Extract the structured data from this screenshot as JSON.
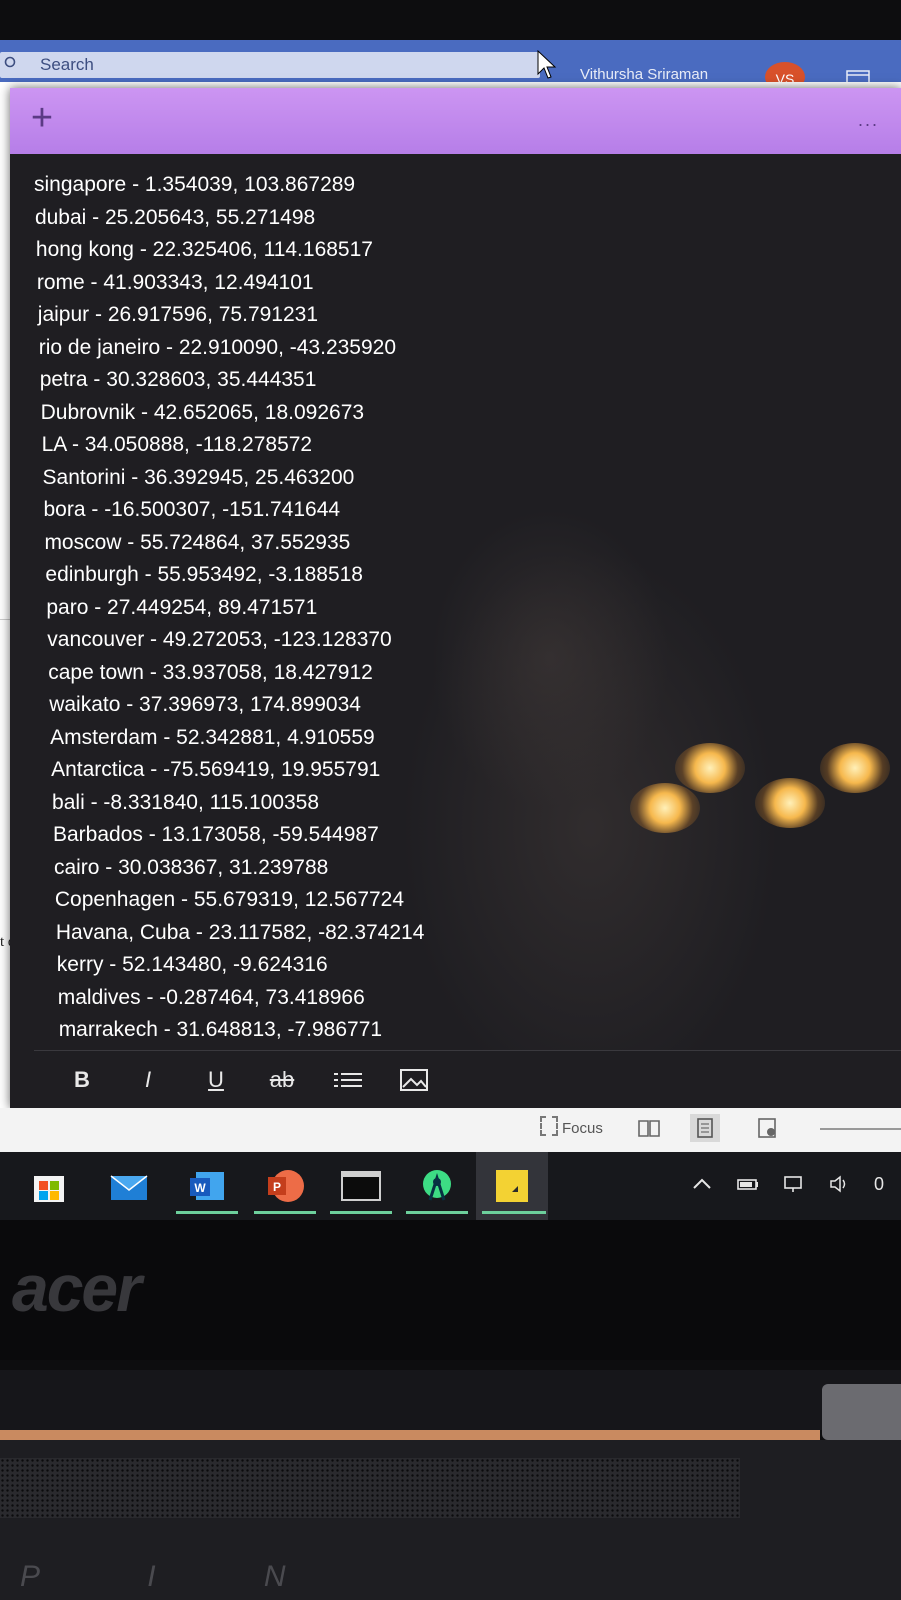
{
  "app": {
    "search_placeholder": "Search",
    "user_name": "Vithursha Sriraman",
    "user_initials": "VS",
    "accent_color": "#4a6bc0"
  },
  "document": {
    "fragment_text": "t d"
  },
  "sticky_note": {
    "header_color": "#c38bef",
    "background_color": "#1f1e22",
    "add_label": "+",
    "more_label": "...",
    "lines": [
      "singapore - 1.354039, 103.867289",
      "dubai - 25.205643, 55.271498",
      "hong kong - 22.325406, 114.168517",
      "rome - 41.903343, 12.494101",
      "jaipur - 26.917596, 75.791231",
      "rio de janeiro - 22.910090, -43.235920",
      "petra - 30.328603, 35.444351",
      "Dubrovnik - 42.652065, 18.092673",
      "LA - 34.050888, -118.278572",
      "Santorini - 36.392945, 25.463200",
      "bora - -16.500307, -151.741644",
      "moscow - 55.724864, 37.552935",
      "edinburgh - 55.953492, -3.188518",
      "paro - 27.449254, 89.471571",
      "vancouver - 49.272053, -123.128370",
      "cape town - 33.937058, 18.427912",
      "waikato - 37.396973, 174.899034",
      "Amsterdam - 52.342881, 4.910559",
      "Antarctica - -75.569419, 19.955791",
      "bali - -8.331840, 115.100358",
      "Barbados - 13.173058, -59.544987",
      "cairo - 30.038367, 31.239788",
      "Copenhagen - 55.679319, 12.567724",
      "Havana, Cuba - 23.117582, -82.374214",
      "kerry - 52.143480, -9.624316",
      "maldives - -0.287464, 73.418966",
      "marrakech - 31.648813, -7.986771"
    ],
    "toolbar": {
      "bold": "B",
      "italic": "I",
      "underline": "U",
      "strikethrough": "ab"
    }
  },
  "status_bar": {
    "focus_label": "Focus"
  },
  "taskbar": {
    "apps": [
      "store-icon",
      "mail-icon",
      "word-icon",
      "powerpoint-icon",
      "terminal-icon",
      "android-studio-icon",
      "sticky-notes-icon"
    ],
    "tray_partial": "0"
  },
  "laptop": {
    "brand": "acer",
    "keycaps": "P I N"
  }
}
